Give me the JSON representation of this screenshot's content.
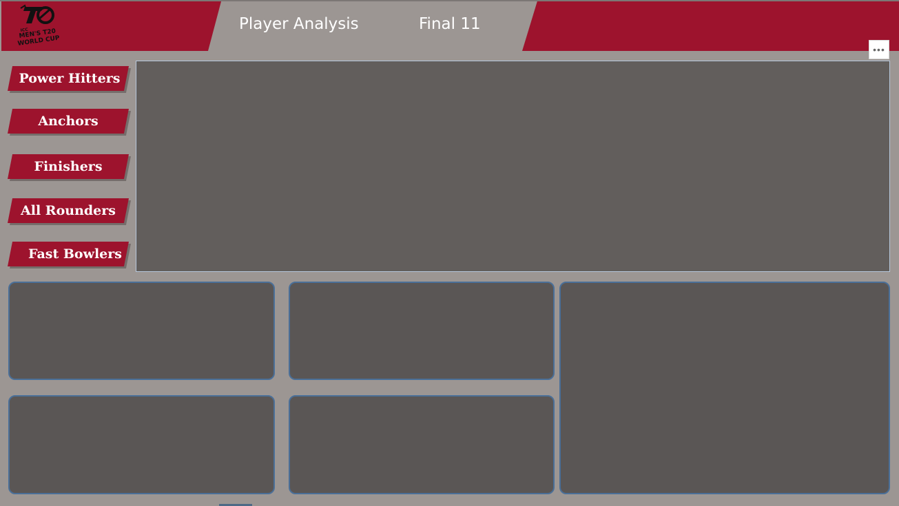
{
  "header": {
    "logo": {
      "icon": "icc-t20-world-cup-logo",
      "lines": [
        "ICC",
        "MEN'S T20",
        "WORLD CUP"
      ],
      "mark": "T20"
    },
    "tabs": [
      {
        "label": "Player Analysis"
      },
      {
        "label": "Final 11"
      }
    ],
    "more_button": {
      "icon": "more-options-icon",
      "glyph": "•••"
    }
  },
  "sidebar": {
    "buttons": [
      {
        "label": "Power Hitters"
      },
      {
        "label": "Anchors"
      },
      {
        "label": "Finishers"
      },
      {
        "label": "All Rounders"
      },
      {
        "label": "Fast Bowlers"
      }
    ]
  },
  "colors": {
    "brand_red": "#9d132d",
    "background": "#9c9693",
    "main_panel": "#625e5c",
    "card_fill": "#5a5655",
    "card_border": "#4a6f98"
  }
}
